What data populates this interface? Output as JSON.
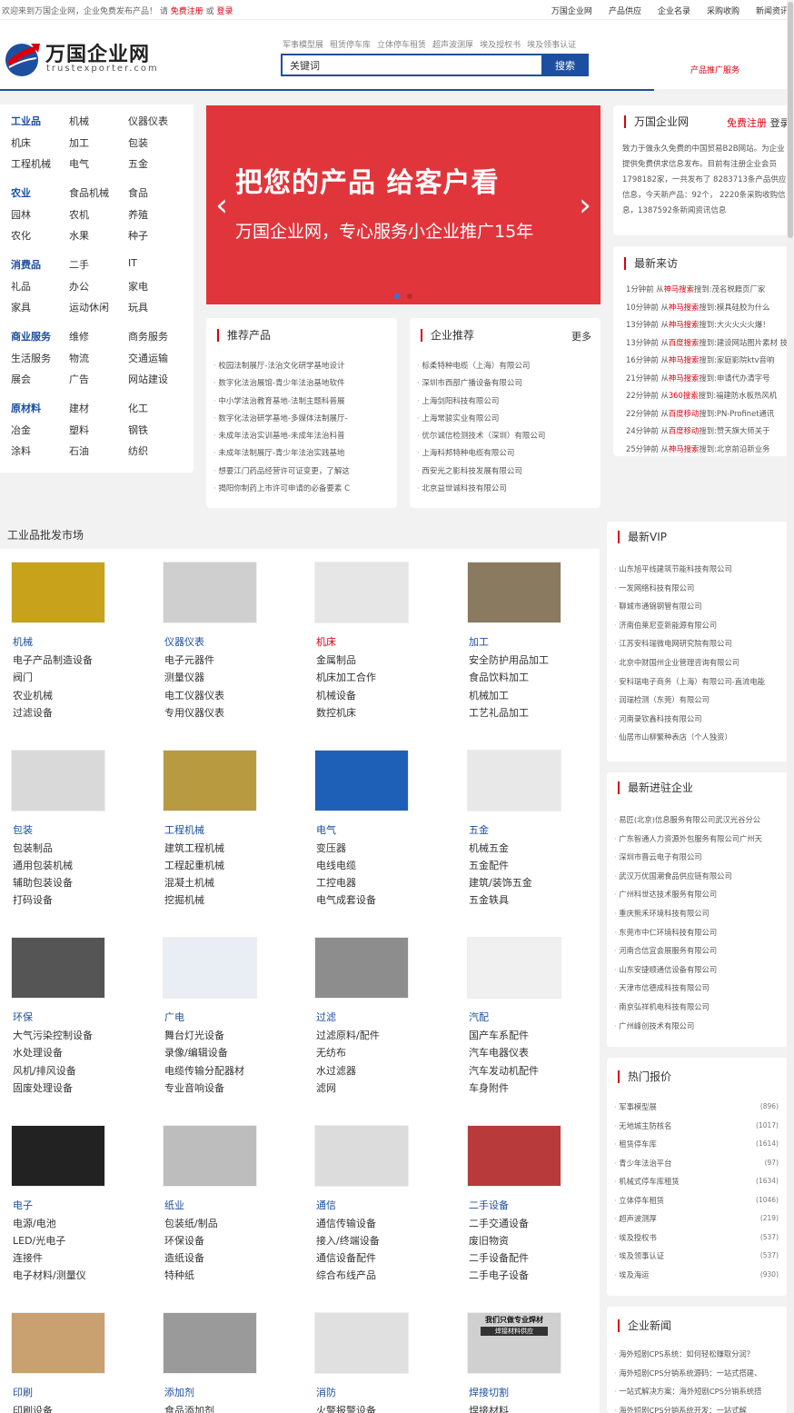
{
  "topbar": {
    "welcome": "欢迎来到万国企业网，企业免费发布产品！ 请",
    "register": "免费注册",
    "or": "或",
    "login": "登录",
    "nav": [
      "万国企业网",
      "产品供应",
      "企业名录",
      "采购收购",
      "新闻资讯"
    ]
  },
  "header": {
    "logo_text": "万国企业网",
    "logo_sub": "trustexporter.com",
    "hot_words": [
      "军事模型展",
      "租赁停车库",
      "立体停车租赁",
      "超声波测厚",
      "埃及授权书",
      "埃及领事认证"
    ],
    "search_placeholder": "关键词",
    "search_button": "搜索",
    "promo": "产品推广服务"
  },
  "categories": [
    {
      "head": "工业品",
      "items": [
        "机械",
        "仪器仪表",
        "机床",
        "加工",
        "包装",
        "工程机械",
        "电气",
        "五金"
      ]
    },
    {
      "head": "农业",
      "items": [
        "食品机械",
        "食品",
        "园林",
        "农机",
        "养殖",
        "农化",
        "水果",
        "种子"
      ]
    },
    {
      "head": "消费品",
      "items": [
        "二手",
        "IT",
        "礼品",
        "办公",
        "家电",
        "家具",
        "运动休闲",
        "玩具"
      ]
    },
    {
      "head": "商业服务",
      "items": [
        "维修",
        "商务服务",
        "生活服务",
        "物流",
        "交通运输",
        "展会",
        "广告",
        "网站建设"
      ]
    },
    {
      "head": "原材料",
      "items": [
        "建材",
        "化工",
        "冶金",
        "塑料",
        "钢铁",
        "涂料",
        "石油",
        "纺织"
      ]
    }
  ],
  "banner": {
    "line1": "把您的产品 给客户看",
    "line2": "万国企业网，专心服务小企业推广15年",
    "prev": "‹",
    "next": "›"
  },
  "recommend_products": {
    "title": "推荐产品",
    "items": [
      "校园法制展厅-法治文化研学基地设计",
      "数字化法治展馆-青少年法治基地软件",
      "中小学法治教育基地-法制主题科普展",
      "数字化法治研学基地-多媒体法制展厅-",
      "未成年法治实训基地-未成年法治科普",
      "未成年法制展厅-青少年法治实践基地",
      "想要江门药品经营许可证变更，了解这",
      "揭阳你制药上市许可申请的必备要素 C"
    ]
  },
  "recommend_companies": {
    "title": "企业推荐",
    "more": "更多",
    "items": [
      "标柔特种电缆（上海）有限公司",
      "深圳市西部广播设备有限公司",
      "上海剑阳科技有限公司",
      "上海常骏实业有限公司",
      "优尔诚信检测技术（深圳）有限公司",
      "上海科邦特种电缆有限公司",
      "西安光之影科技发展有限公司",
      "北京益世诚科技有限公司"
    ]
  },
  "intro": {
    "title": "万国企业网",
    "register": "免费注册",
    "login": "登录",
    "desc": "致力于做永久免费的中国贸易B2B网站。为企业提供免费供求信息发布。目前有注册企业会员 1798182家，一共发布了 8283713条产品供应信息，今天新产品：92个， 2220条采购收购信息，1387592条新闻资讯信息"
  },
  "visits": {
    "title": "最新来访",
    "items": [
      {
        "time": "1分钟前 从",
        "engine": "神马搜索",
        "kw": "搜到:茂名税籍页厂家"
      },
      {
        "time": "10分钟前 从",
        "engine": "神马搜索",
        "kw": "搜到:模具硅胶为什么"
      },
      {
        "time": "13分钟前 从",
        "engine": "神马搜索",
        "kw": "搜到:大火火火火爆！"
      },
      {
        "time": "13分钟前 从",
        "engine": "百度搜索",
        "kw": "搜到:建设网站图片素材 技"
      },
      {
        "time": "16分钟前 从",
        "engine": "神马搜索",
        "kw": "搜到:家庭影院ktv音响"
      },
      {
        "time": "21分钟前 从",
        "engine": "神马搜索",
        "kw": "搜到:申请代办清字号"
      },
      {
        "time": "22分钟前 从",
        "engine": "360搜索",
        "kw": "搜到:福建防水板热风机"
      },
      {
        "time": "22分钟前 从",
        "engine": "百度移动",
        "kw": "搜到:PN-Profinet通讯"
      },
      {
        "time": "24分钟前 从",
        "engine": "百度移动",
        "kw": "搜到:赞天旗大师关于"
      },
      {
        "time": "25分钟前 从",
        "engine": "神马搜索",
        "kw": "搜到:北京前沿新业务"
      }
    ]
  },
  "market": {
    "title": "工业品批发市场",
    "cells": [
      {
        "name": "机械",
        "subs": [
          "电子产品制造设备",
          "阀门",
          "农业机械",
          "过滤设备"
        ],
        "color": "#c7a21a"
      },
      {
        "name": "仪器仪表",
        "subs": [
          "电子元器件",
          "测量仪器",
          "电工仪器仪表",
          "专用仪器仪表"
        ],
        "color": "#cfcfcf"
      },
      {
        "name": "机床",
        "subs": [
          "金属制品",
          "机床加工合作",
          "机械设备",
          "数控机床"
        ],
        "color": "#e6e6e6",
        "red": true
      },
      {
        "name": "加工",
        "subs": [
          "安全防护用品加工",
          "食品饮料加工",
          "机械加工",
          "工艺礼品加工"
        ],
        "color": "#8a7a60"
      },
      {
        "name": "包装",
        "subs": [
          "包装制品",
          "通用包装机械",
          "辅助包装设备",
          "打码设备"
        ],
        "color": "#d9d9d9"
      },
      {
        "name": "工程机械",
        "subs": [
          "建筑工程机械",
          "工程起重机械",
          "混凝土机械",
          "挖掘机械"
        ],
        "color": "#b89a40"
      },
      {
        "name": "电气",
        "subs": [
          "变压器",
          "电线电缆",
          "工控电器",
          "电气成套设备"
        ],
        "color": "#1e5fb8"
      },
      {
        "name": "五金",
        "subs": [
          "机械五金",
          "五金配件",
          "建筑/装饰五金",
          "五金轶具"
        ],
        "color": "#e8e8e8"
      },
      {
        "name": "环保",
        "subs": [
          "大气污染控制设备",
          "水处理设备",
          "风机/排风设备",
          "固废处理设备"
        ],
        "color": "#555555"
      },
      {
        "name": "广电",
        "subs": [
          "舞台灯光设备",
          "录像/编辑设备",
          "电缆传输分配器材",
          "专业音响设备"
        ],
        "color": "#e9eef5"
      },
      {
        "name": "过滤",
        "subs": [
          "过滤原料/配件",
          "无纺布",
          "水过滤器",
          "滤网"
        ],
        "color": "#8d8d8d"
      },
      {
        "name": "汽配",
        "subs": [
          "国产车系配件",
          "汽车电器仪表",
          "汽车发动机配件",
          "车身附件"
        ],
        "color": "#f0f0f0"
      },
      {
        "name": "电子",
        "subs": [
          "电源/电池",
          "LED/光电子",
          "连接件",
          "电子材料/测量仪"
        ],
        "color": "#222222"
      },
      {
        "name": "纸业",
        "subs": [
          "包装纸/制品",
          "环保设备",
          "造纸设备",
          "特种纸"
        ],
        "color": "#bdbdbd"
      },
      {
        "name": "通信",
        "subs": [
          "通信传输设备",
          "接入/终端设备",
          "通信设备配件",
          "综合布线产品"
        ],
        "color": "#dcdcdc"
      },
      {
        "name": "二手设备",
        "subs": [
          "二手交通设备",
          "废旧物资",
          "二手设备配件",
          "二手电子设备"
        ],
        "color": "#b83a3a"
      },
      {
        "name": "印刷",
        "subs": [
          "印刷设备"
        ],
        "color": "#c9a070"
      },
      {
        "name": "添加剂",
        "subs": [
          "食品添加剂"
        ],
        "color": "#9a9a9a"
      },
      {
        "name": "消防",
        "subs": [
          "火警报警设备"
        ],
        "color": "#e0e0e0"
      },
      {
        "name": "焊接切割",
        "subs": [
          "焊接材料"
        ],
        "color": "#d0d0d0"
      }
    ]
  },
  "weld_img_text": [
    "我们只做专业焊材",
    "焊接材料供应"
  ],
  "vip": {
    "title": "最新VIP",
    "items": [
      "山东旭平线建筑节能科技有限公司",
      "一发网络科技有限公司",
      "聊城市通锦钢管有限公司",
      "济南伯莱尼亚新能源有限公司",
      "江苏安科瑞微电网研究院有限公司",
      "北京中财国州企业管理咨询有限公司",
      "安科瑞电子商务（上海）有限公司-直流电能",
      "润瑞检测（东莞）有限公司",
      "河南录钦鑫科技有限公司",
      "仙居市山柳繁种表店（个人独资）"
    ]
  },
  "new_companies": {
    "title": "最新进驻企业",
    "items": [
      "易匠(北京)信息服务有限公司武汉光谷分公",
      "广东智通人力资源外包服务有限公司广州天",
      "深圳市晋云电子有限公司",
      "武汉万优国潮食品供应链有限公司",
      "广州科世达技术服务有限公司",
      "重庆熊禾环境科技有限公司",
      "东莞市中仁环境科技有限公司",
      "河南合信宜会展服务有限公司",
      "山东安捷顺通信设备有限公司",
      "天津市信德成科技有限公司",
      "南京弘祥机电科技有限公司",
      "广州峰创技术有限公司"
    ]
  },
  "quotes": {
    "title": "热门报价",
    "items": [
      {
        "name": "军事模型展",
        "count": "(896)"
      },
      {
        "name": "无地城主防核名",
        "count": "(1017)"
      },
      {
        "name": "租赁停车库",
        "count": "(1614)"
      },
      {
        "name": "青少年法治平台",
        "count": "(97)"
      },
      {
        "name": "机械式停车库租赁",
        "count": "(1634)"
      },
      {
        "name": "立体停车租赁",
        "count": "(1046)"
      },
      {
        "name": "超声波测厚",
        "count": "(219)"
      },
      {
        "name": "埃及授权书",
        "count": "(537)"
      },
      {
        "name": "埃及领事认证",
        "count": "(537)"
      },
      {
        "name": "埃及海运",
        "count": "(930)"
      }
    ]
  },
  "news": {
    "title": "企业新闻",
    "items": [
      "海外短剧CPS系统：如何轻松赚取分润？",
      "海外短剧CPS分销系统源码：一站式搭建、",
      "一站式解决方案：海外短剧CPS分销系统搭",
      "海外短剧CPS分销系统开发：一站式解"
    ]
  }
}
